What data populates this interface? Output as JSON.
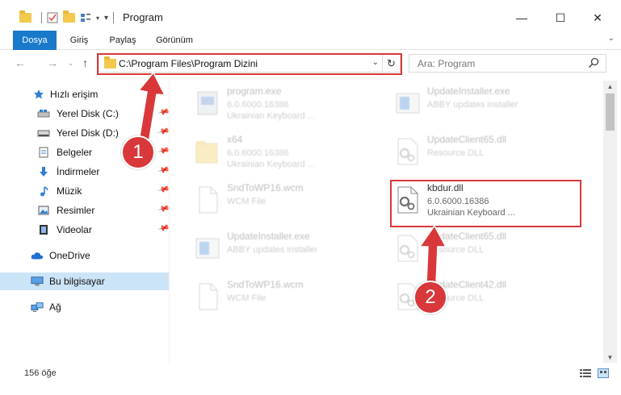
{
  "window": {
    "title": "Program",
    "controls": {
      "minimize": "—",
      "maximize": "☐",
      "close": "✕"
    }
  },
  "ribbon": {
    "tabs": [
      {
        "label": "Dosya",
        "active": true
      },
      {
        "label": "Giriş"
      },
      {
        "label": "Paylaş"
      },
      {
        "label": "Görünüm"
      }
    ],
    "expand_icon": "chevron-down-icon"
  },
  "address": {
    "path": "C:\\Program Files\\Program Dizini",
    "search_placeholder": "Ara: Program"
  },
  "sidebar": {
    "items": [
      {
        "label": "Hızlı erişim",
        "icon": "star-icon"
      },
      {
        "label": "Yerel Disk (C:)",
        "icon": "drive-icon",
        "pinned": true
      },
      {
        "label": "Yerel Disk (D:)",
        "icon": "drive-icon",
        "pinned": true
      },
      {
        "label": "Belgeler",
        "icon": "documents-icon",
        "pinned": true
      },
      {
        "label": "İndirmeler",
        "icon": "download-icon",
        "pinned": true
      },
      {
        "label": "Müzik",
        "icon": "music-icon",
        "pinned": true
      },
      {
        "label": "Resimler",
        "icon": "pictures-icon",
        "pinned": true
      },
      {
        "label": "Videolar",
        "icon": "videos-icon",
        "pinned": true
      },
      {
        "label": "OneDrive",
        "icon": "cloud-icon"
      },
      {
        "label": "Bu bilgisayar",
        "icon": "computer-icon",
        "selected": true
      },
      {
        "label": "Ağ",
        "icon": "network-icon"
      }
    ]
  },
  "files": {
    "left": [
      {
        "name": "program.exe",
        "line1": "6.0.6000.16386",
        "line2": "Ukrainian Keyboard ...",
        "icon": "exe-icon"
      },
      {
        "name": "x64",
        "line1": "6.0.6000.16386",
        "line2": "Ukrainian Keyboard ...",
        "icon": "folder-icon"
      },
      {
        "name": "SndToWP16.wcm",
        "line1": "WCM File",
        "line2": "",
        "icon": "blank-file-icon"
      },
      {
        "name": "UpdateInstaller.exe",
        "line1": "ABBY updates installer",
        "line2": "",
        "icon": "installer-icon"
      },
      {
        "name": "SndToWP16.wcm",
        "line1": "WCM File",
        "line2": "",
        "icon": "blank-file-icon"
      }
    ],
    "right": [
      {
        "name": "UpdateInstaller.exe",
        "line1": "ABBY updates installer",
        "line2": "",
        "icon": "installer-icon"
      },
      {
        "name": "UpdateClient65.dll",
        "line1": "Resource DLL",
        "line2": "",
        "icon": "dll-icon"
      },
      {
        "name": "kbdur.dll",
        "line1": "6.0.6000.16386",
        "line2": "Ukrainian Keyboard ...",
        "icon": "dll-icon",
        "highlighted": true
      },
      {
        "name": "UpdateClient65.dll",
        "line1": "Resource DLL",
        "line2": "",
        "icon": "dll-icon"
      },
      {
        "name": "UpdateClient42.dll",
        "line1": "Resource DLL",
        "line2": "",
        "icon": "dll-icon"
      }
    ]
  },
  "annotations": {
    "badge1": "1",
    "badge2": "2",
    "color": "#d9383a"
  },
  "status": {
    "count": "156 öğe"
  },
  "colors": {
    "accent": "#1979ca",
    "selected_bg": "#cce4f7"
  }
}
